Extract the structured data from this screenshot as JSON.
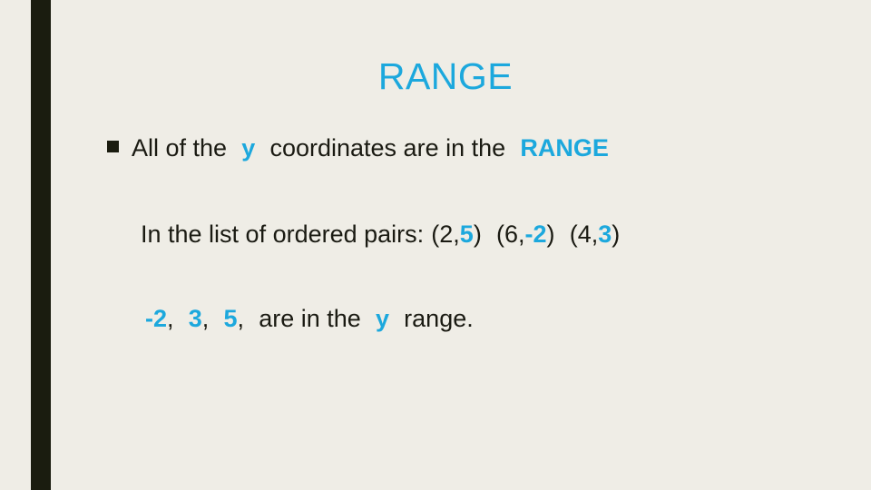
{
  "slide": {
    "title": "RANGE",
    "accent_color": "#1CA8DD",
    "text_color": "#1A1A12",
    "background_color": "#EFEDE6",
    "accent_bar_color": "#1A1C0F",
    "bullet_marker": "square-bullet"
  },
  "lines": {
    "line1": {
      "bullet": "■",
      "part1": "All  of  the",
      "highlight1": "y",
      "part2": "coordinates  are  in  the",
      "highlight2": "RANGE"
    },
    "line2": {
      "lead": "In  the  list  of  ordered  pairs:",
      "pairs": [
        {
          "open": "(2,",
          "y": "5",
          "close": ")"
        },
        {
          "open": "(6,",
          "y": "-2",
          "close": ")"
        },
        {
          "open": "(4,",
          "y": "3",
          "close": ")"
        }
      ]
    },
    "line3": {
      "values": [
        "-2",
        "3",
        "5"
      ],
      "separator": ",",
      "middle": "are  in  the",
      "highlight": "y",
      "tail": "range."
    }
  }
}
